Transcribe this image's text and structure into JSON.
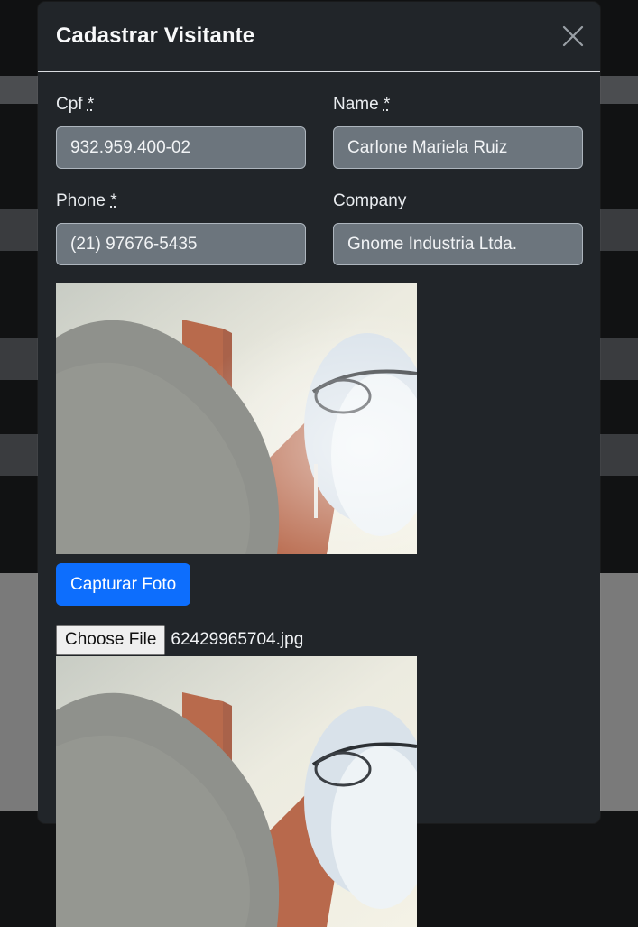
{
  "modal": {
    "title": "Cadastrar Visitante",
    "close_icon": "close-icon"
  },
  "form": {
    "cpf": {
      "label": "Cpf",
      "required_mark": "*",
      "value": "932.959.400-02"
    },
    "name": {
      "label": "Name",
      "required_mark": "*",
      "value": "Carlone Mariela Ruiz"
    },
    "phone": {
      "label": "Phone",
      "required_mark": "*",
      "value": "(21) 97676-5435"
    },
    "company": {
      "label": "Company",
      "value": "Gnome Industria Ltda."
    }
  },
  "camera": {
    "capture_label": "Capturar Foto"
  },
  "file_input": {
    "button_label": "Choose File",
    "file_name": "62429965704.jpg"
  },
  "colors": {
    "modal_bg": "#212529",
    "input_bg": "#6c757d",
    "primary": "#0d6efd"
  }
}
